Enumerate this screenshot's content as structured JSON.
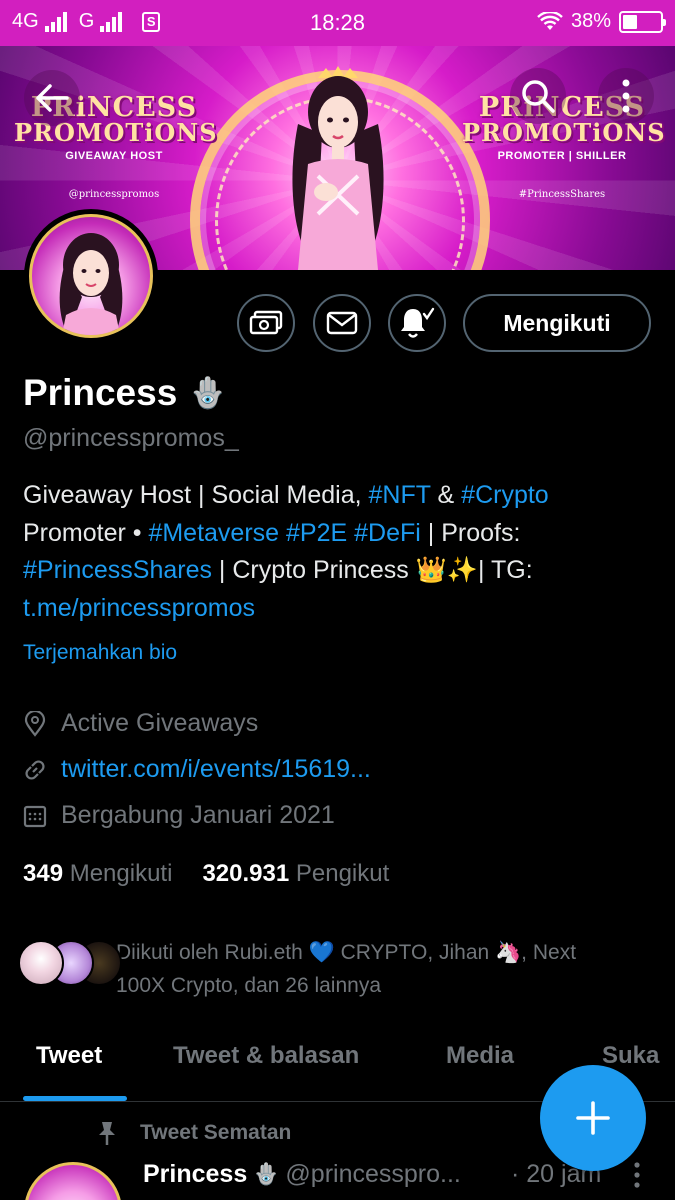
{
  "status_bar": {
    "network_1": "4G",
    "network_2": "G",
    "sim_label": "S",
    "time": "18:28",
    "battery": "38%",
    "battery_level": 0.38
  },
  "banner": {
    "left_brand_line1": "PRiNCESS",
    "left_brand_line2": "PROMOTiONS",
    "left_subtitle": "GIVEAWAY HOST",
    "left_handle": "@princesspromos",
    "right_brand_line1": "PRiNCESS",
    "right_brand_line2": "PROMOTiONS",
    "right_subtitle": "PROMOTER | SHILLER",
    "right_handle": "#PrincessShares",
    "icons": {
      "back": "back-arrow-icon",
      "search": "search-icon",
      "more": "more-vertical-icon"
    }
  },
  "profile": {
    "name": "Princess",
    "name_emoji": "🪬",
    "handle": "@princesspromos_",
    "bio": {
      "l1_a": "Giveaway Host | Social Media, ",
      "l1_tag1": "#NFT",
      "l1_b": " & ",
      "l1_tag2": "#Crypto",
      "l2_a": "Promoter • ",
      "l2_tag1": "#Metaverse",
      "l2_tag2": "#P2E",
      "l2_tag3": "#DeFi",
      "l2_b": " | Proofs:",
      "l3_tag": "#PrincessShares",
      "l3_b": " | Crypto Princess 👑✨| TG:",
      "l4_link": "t.me/princesspromos"
    },
    "translate_bio": "Terjemahkan bio",
    "location": "Active Giveaways",
    "website": "twitter.com/i/events/15619...",
    "joined": "Bergabung Januari 2021",
    "following_count": "349",
    "following_label": "Mengikuti",
    "followers_count": "320.931",
    "followers_label": "Pengikut",
    "followed_by_l1": "Diikuti oleh Rubi.eth 💙 CRYPTO, Jihan 🦄, Next",
    "followed_by_l2": "100X Crypto, dan 26 lainnya"
  },
  "actions": {
    "follow_button": "Mengikuti",
    "icons": {
      "tip": "money-icon",
      "message": "envelope-icon",
      "notify": "bell-check-icon"
    }
  },
  "tabs": [
    {
      "label": "Tweet"
    },
    {
      "label": "Tweet & balasan"
    },
    {
      "label": "Media"
    },
    {
      "label": "Suka"
    }
  ],
  "pinned_tweet": {
    "pinned_label": "Tweet Sematan",
    "name": "Princess",
    "name_emoji": "🪬",
    "handle": "@princesspro...",
    "time": "· 20 jam"
  },
  "colors": {
    "accent": "#1d9bf0",
    "status_bar": "#d21fbf",
    "background": "#000000",
    "secondary_text": "#71767b",
    "border": "#536471"
  }
}
